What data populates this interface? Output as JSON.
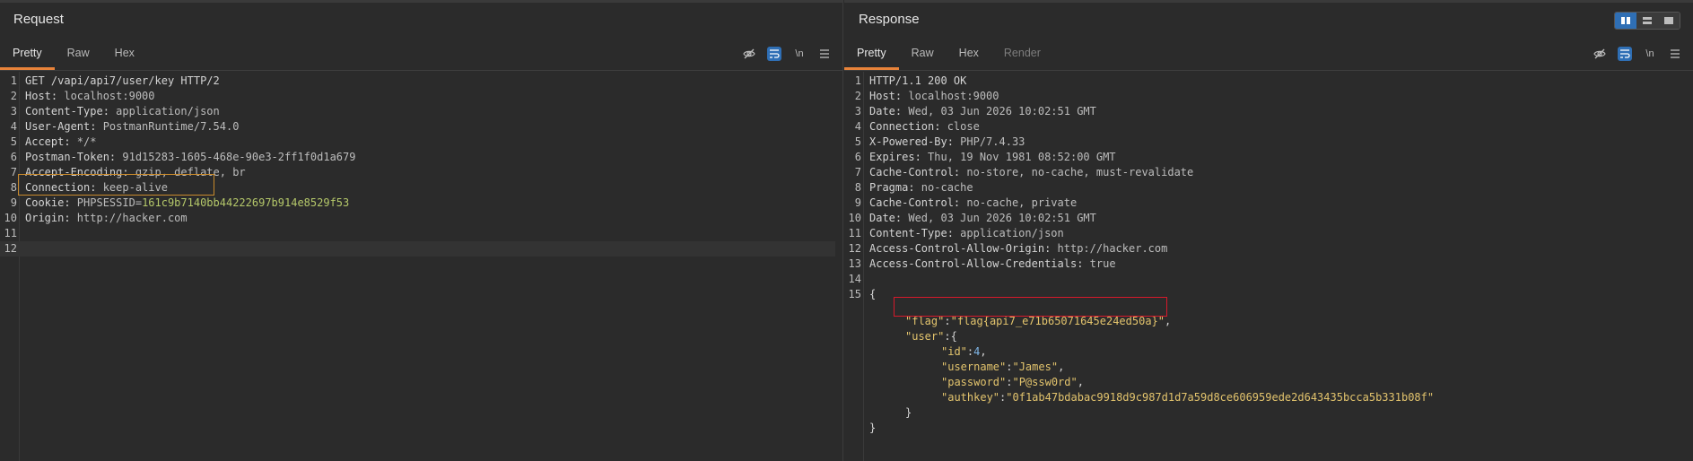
{
  "request": {
    "title": "Request",
    "tabs": [
      "Pretty",
      "Raw",
      "Hex"
    ],
    "active_tab": "Pretty",
    "toolbar": {
      "hide_icon": "eye-off-icon",
      "wrap_icon": "wrap-icon",
      "newline_label": "\\n",
      "menu_icon": "menu-icon"
    },
    "lines": [
      {
        "n": "1",
        "key": "GET /vapi/api7/user/key HTTP/2",
        "val": ""
      },
      {
        "n": "2",
        "key": "Host:",
        "val": " localhost:9000"
      },
      {
        "n": "3",
        "key": "Content-Type:",
        "val": " application/json"
      },
      {
        "n": "4",
        "key": "User-Agent:",
        "val": " PostmanRuntime/7.54.0"
      },
      {
        "n": "5",
        "key": "Accept:",
        "val": " */*"
      },
      {
        "n": "6",
        "key": "Postman-Token:",
        "val": " 91d15283-1605-468e-90e3-2ff1f0d1a679"
      },
      {
        "n": "7",
        "key": "Accept-Encoding:",
        "val": " gzip, deflate, br"
      },
      {
        "n": "8",
        "key": "Connection:",
        "val": " keep-alive"
      },
      {
        "n": "9",
        "key": "Cookie:",
        "val": " PHPSESSID=",
        "extra": "161c9b7140bb44222697b914e8529f53"
      },
      {
        "n": "10",
        "key": "Origin:",
        "val": " http://hacker.com"
      },
      {
        "n": "11",
        "key": "",
        "val": ""
      },
      {
        "n": "12",
        "key": "",
        "val": ""
      }
    ]
  },
  "response": {
    "title": "Response",
    "tabs": [
      "Pretty",
      "Raw",
      "Hex",
      "Render"
    ],
    "active_tab": "Pretty",
    "toolbar": {
      "hide_icon": "eye-off-icon",
      "wrap_icon": "wrap-icon",
      "newline_label": "\\n",
      "menu_icon": "menu-icon"
    },
    "lines": [
      {
        "n": "1",
        "key": "HTTP/1.1 200 OK",
        "val": ""
      },
      {
        "n": "2",
        "key": "Host:",
        "val": " localhost:9000"
      },
      {
        "n": "3",
        "key": "Date:",
        "val": " Wed, 03 Jun 2026 10:02:51 GMT"
      },
      {
        "n": "4",
        "key": "Connection:",
        "val": " close"
      },
      {
        "n": "5",
        "key": "X-Powered-By:",
        "val": " PHP/7.4.33"
      },
      {
        "n": "6",
        "key": "Expires:",
        "val": " Thu, 19 Nov 1981 08:52:00 GMT"
      },
      {
        "n": "7",
        "key": "Cache-Control:",
        "val": " no-store, no-cache, must-revalidate"
      },
      {
        "n": "8",
        "key": "Pragma:",
        "val": " no-cache"
      },
      {
        "n": "9",
        "key": "Cache-Control:",
        "val": " no-cache, private"
      },
      {
        "n": "10",
        "key": "Date:",
        "val": " Wed, 03 Jun 2026 10:02:51 GMT"
      },
      {
        "n": "11",
        "key": "Content-Type:",
        "val": " application/json"
      },
      {
        "n": "12",
        "key": "Access-Control-Allow-Origin:",
        "val": " http://hacker.com"
      },
      {
        "n": "13",
        "key": "Access-Control-Allow-Credentials:",
        "val": " true"
      },
      {
        "n": "14",
        "key": "",
        "val": ""
      },
      {
        "n": "15",
        "key": "{",
        "val": ""
      }
    ],
    "json_body": {
      "flag_key": "\"flag\"",
      "flag_val": "\"flag{api7_e71b65071645e24ed50a}\"",
      "user_key": "\"user\"",
      "id_key": "\"id\"",
      "id_val": "4",
      "username_key": "\"username\"",
      "username_val": "\"James\"",
      "password_key": "\"password\"",
      "password_val": "\"P@ssw0rd\"",
      "authkey_key": "\"authkey\"",
      "authkey_val": "\"0f1ab47bdabac9918d9c987d1d7a59d8ce606959ede2d643435bcca5b331b08f\"",
      "inner_close": "}",
      "outer_close": "}"
    }
  },
  "colors": {
    "accent_tab": "#e8833a",
    "highlight_request": "#c98a2c",
    "highlight_response": "#d7192b",
    "toggle_on": "#2f6fb5"
  }
}
